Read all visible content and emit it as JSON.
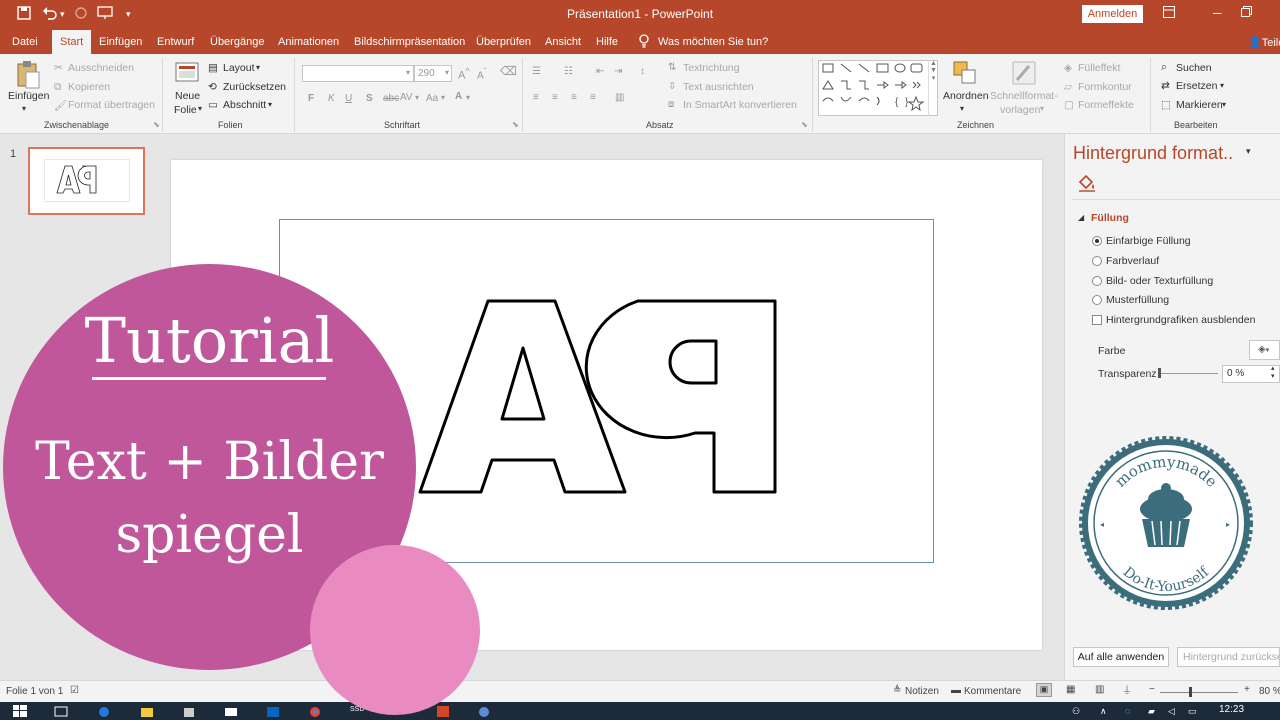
{
  "titlebar": {
    "title": "Präsentation1 - PowerPoint",
    "signin_label": "Anmelden",
    "qa_save_icon": "save-icon",
    "qa_undo_icon": "undo-icon",
    "qa_redo_icon": "redo-icon",
    "qa_start_icon": "presentation-icon",
    "qa_more_icon": "chevron-down-icon"
  },
  "tabs": [
    {
      "label": "Datei"
    },
    {
      "label": "Start"
    },
    {
      "label": "Einfügen"
    },
    {
      "label": "Entwurf"
    },
    {
      "label": "Übergänge"
    },
    {
      "label": "Animationen"
    },
    {
      "label": "Bildschirmpräsentation"
    },
    {
      "label": "Überprüfen"
    },
    {
      "label": "Ansicht"
    },
    {
      "label": "Hilfe"
    }
  ],
  "tell_me": "Was möchten Sie tun?",
  "share_label": "Teile",
  "ribbon": {
    "clipboard": {
      "paste_label": "Einfügen",
      "cut_label": "Ausschneiden",
      "copy_label": "Kopieren",
      "format_label": "Format übertragen",
      "group_label": "Zwischenablage"
    },
    "slides": {
      "new_slide_label1": "Neue",
      "new_slide_label2": "Folie",
      "layout_label": "Layout",
      "reset_label": "Zurücksetzen",
      "section_label": "Abschnitt",
      "group_label": "Folien"
    },
    "font": {
      "font_size": "290",
      "bold": "F",
      "italic": "K",
      "underline": "U",
      "strike": "S",
      "shadow": "abc",
      "spacing": "AV",
      "case": "Aa",
      "group_label": "Schriftart"
    },
    "paragraph": {
      "text_direction": "Textrichtung",
      "align_text": "Text ausrichten",
      "smartart": "In SmartArt konvertieren",
      "group_label": "Absatz"
    },
    "drawing": {
      "arrange_label": "Anordnen",
      "quick_styles_label1": "Schnellformat-",
      "quick_styles_label2": "vorlagen",
      "fill_label": "Fülleffekt",
      "outline_label": "Formkontur",
      "effects_label": "Formeffekte",
      "group_label": "Zeichnen"
    },
    "editing": {
      "find_label": "Suchen",
      "replace_label": "Ersetzen",
      "select_label": "Markieren",
      "group_label": "Bearbeiten"
    }
  },
  "thumbnails": [
    {
      "number": "1",
      "text": "ꟼA"
    }
  ],
  "slide": {
    "mirrored_text": "ꟼA"
  },
  "pane": {
    "title": "Hintergrund format..",
    "section": "Füllung",
    "options": [
      {
        "label": "Einfarbige Füllung",
        "selected": true
      },
      {
        "label": "Farbverlauf",
        "selected": false
      },
      {
        "label": "Bild- oder Texturfüllung",
        "selected": false
      },
      {
        "label": "Musterfüllung",
        "selected": false
      }
    ],
    "hide_graphics": "Hintergrundgrafiken ausblenden",
    "color_label": "Farbe",
    "transparency_label": "Transparenz",
    "transparency_value": "0 %",
    "apply_all": "Auf alle anwenden",
    "reset_bg": "Hintergrund zurücksetzen"
  },
  "statusbar": {
    "slide_info": "Folie 1 von 1",
    "notes": "Notizen",
    "comments": "Kommentare",
    "zoom": "80 %"
  },
  "taskbar": {
    "time": "12:23",
    "ssd_label": "SSD"
  },
  "overlay": {
    "line1": "Tutorial",
    "line2": "Text + Bilder",
    "line3": "spiegel",
    "badge_top": "mommymade",
    "badge_bottom": "Do-It-Yourself"
  },
  "colors": {
    "accent": "#b7472a",
    "circle_big": "#c0579a",
    "circle_small": "#e98bc0",
    "badge": "#3c6d7c"
  }
}
